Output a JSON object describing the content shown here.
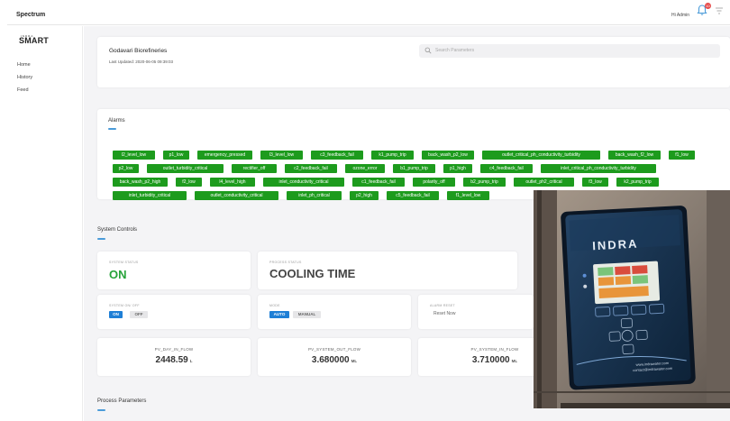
{
  "topbar": {
    "brand": "Spectrum",
    "user_greeting": "Hi Admin",
    "notification_count": "10"
  },
  "sidebar": {
    "logo_small": "INDRA",
    "logo": "SMART",
    "items": [
      {
        "label": "Home"
      },
      {
        "label": "History"
      },
      {
        "label": "Feed"
      }
    ]
  },
  "header": {
    "organization": "Godavari Biorefineries",
    "last_updated": "Last Updated: 2020-06-05 09:39:03",
    "search_placeholder": "Search Parameters"
  },
  "alarms": {
    "title": "Alarms",
    "rows": [
      [
        "l2_level_low",
        "p1_low",
        "emergency_pressed",
        "l3_level_low",
        "c3_feedback_fail",
        "k1_pump_trip",
        "back_wash_p2_low",
        "outlet_critical_ph_conductivity_turbidity",
        "back_wash_f2_low",
        "f1_low"
      ],
      [
        "p2_low",
        "outlet_turbidity_critical",
        "rectifier_off",
        "c2_feedback_fail",
        "ozone_error",
        "b1_pump_trip",
        "p1_high",
        "c4_feedback_fail",
        "inlet_critical_ph_conductivity_turbidity"
      ],
      [
        "back_wash_p2_high",
        "f2_low",
        "l4_level_high",
        "inlet_conductivity_critical",
        "c1_feedback_fail",
        "polarity_off",
        "b2_pump_trip",
        "outlet_ph2_critical",
        "f3_low",
        "k2_pump_trip"
      ],
      [
        "inlet_turbidity_critical",
        "outlet_conductivity_critical",
        "inlet_ph_critical",
        "p2_high",
        "c5_feedback_fail",
        "f1_level_low"
      ]
    ]
  },
  "controls": {
    "title": "System Controls",
    "system_status_label": "SYSTEM STATUS",
    "system_status": "ON",
    "process_status_label": "PROCESS STATUS",
    "process_status": "COOLING TIME",
    "system_onoff_label": "SYSTEM ON/ OFF",
    "on_label": "ON",
    "off_label": "OFF",
    "mode_label": "MODE",
    "auto_label": "AUTO",
    "manual_label": "MANUAL",
    "alarm_reset_label": "ALARM RESET",
    "reset_now": "Reset Now"
  },
  "flows": [
    {
      "label": "PV_DAY_IN_FLOW",
      "value": "2448.59",
      "unit": "L"
    },
    {
      "label": "PV_SYSTEM_OUT_FLOW",
      "value": "3.680000",
      "unit": "ML"
    },
    {
      "label": "PV_SYSTEM_IN_FLOW",
      "value": "3.710000",
      "unit": "ML"
    }
  ],
  "process_parameters": {
    "title": "Process Parameters"
  },
  "device_photo": {
    "brand": "INDRA",
    "website": "www.indrawater.com",
    "email": "contact@indrawater.com",
    "colors": {
      "enclosure": "#16324f",
      "screen_green": "#7ac47a",
      "screen_red": "#d94c3d",
      "screen_orange": "#e8953a"
    }
  }
}
